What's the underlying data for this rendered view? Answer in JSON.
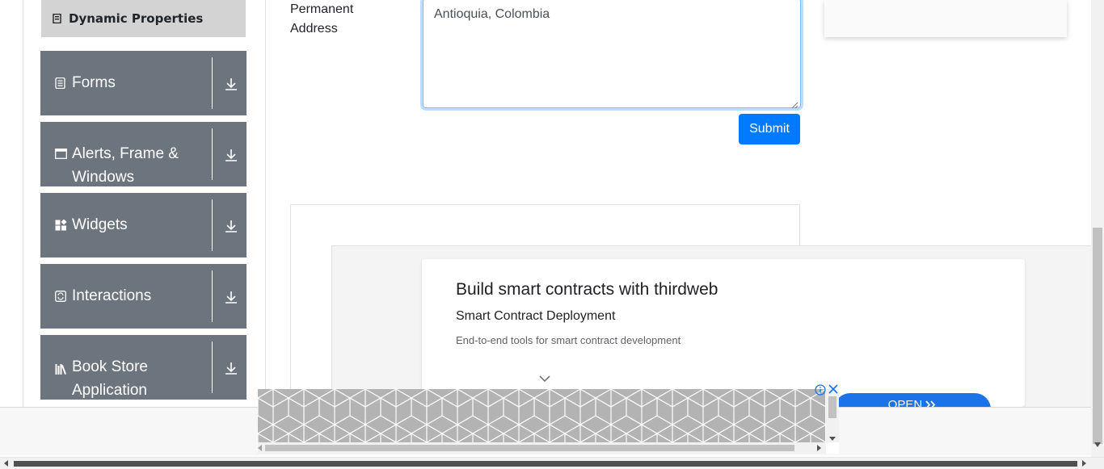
{
  "sidebar": {
    "dynamic_properties": {
      "label": "Dynamic Properties",
      "icon": "list-icon"
    },
    "groups": [
      {
        "label": "Forms",
        "icon": "form-icon"
      },
      {
        "label": "Alerts, Frame & Windows",
        "icon": "window-icon"
      },
      {
        "label": "Widgets",
        "icon": "widgets-icon"
      },
      {
        "label": "Interactions",
        "icon": "interactions-icon"
      },
      {
        "label": "Book Store Application",
        "icon": "books-icon"
      }
    ]
  },
  "form": {
    "permanent_address_label": "Permanent Address",
    "permanent_address_value": "Antioquia, Colombia",
    "submit_label": "Submit"
  },
  "ad": {
    "title": "Build smart contracts with thirdweb",
    "subtitle": "Smart Contract Deployment",
    "description": "End-to-end tools for smart contract development",
    "cta_label": "OPEN",
    "cta_color": "#1a73e8"
  },
  "colors": {
    "accent": "#007bff",
    "sidebar_group": "#6c757d",
    "sidebar_active": "#d3d3d3"
  }
}
